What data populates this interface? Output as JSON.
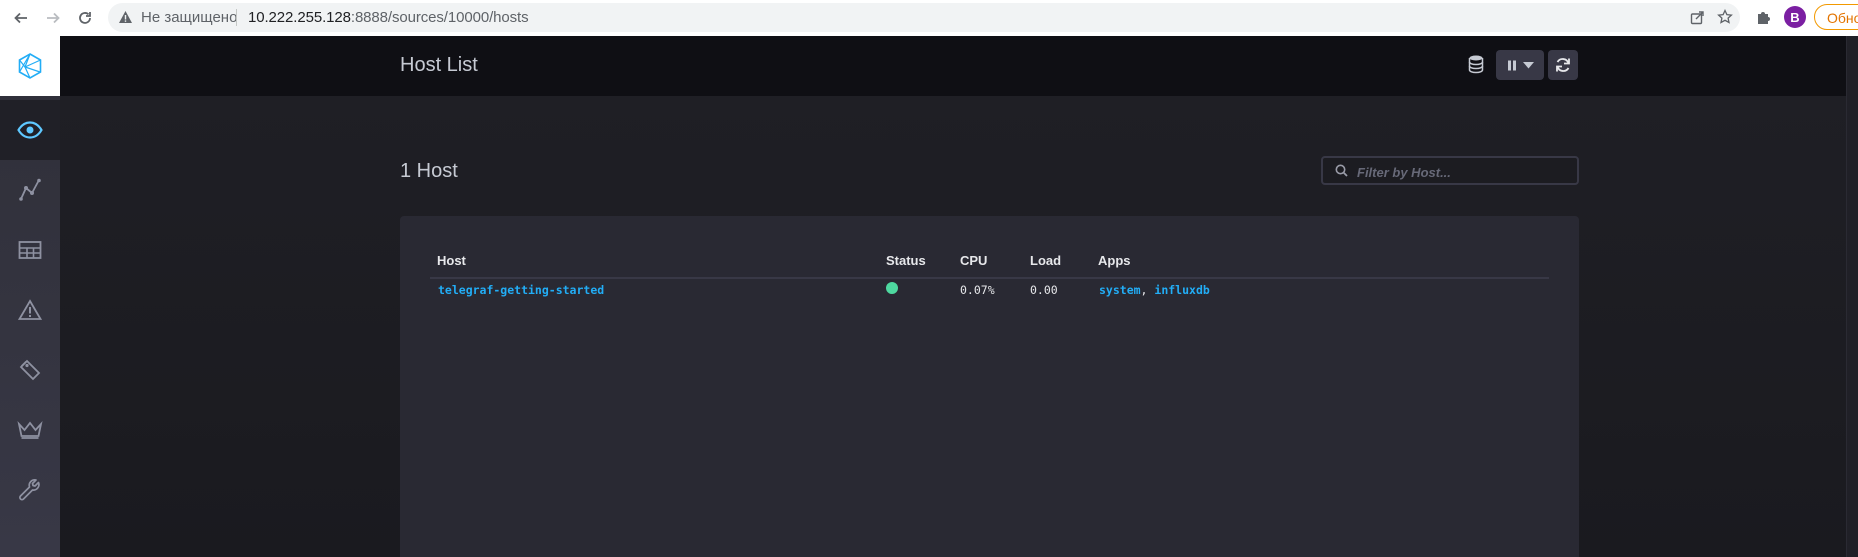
{
  "browser": {
    "security_label": "Не защищено",
    "url_host": "10.222.255.128",
    "url_rest": ":8888/sources/10000/hosts",
    "profile_initial": "B",
    "update_label": "Обновить"
  },
  "header": {
    "title": "Host List"
  },
  "sidebar": {
    "items": [
      {
        "icon": "eye-icon",
        "active": true
      },
      {
        "icon": "graph-icon",
        "active": false
      },
      {
        "icon": "dashboards-icon",
        "active": false
      },
      {
        "icon": "alert-icon",
        "active": false
      },
      {
        "icon": "tag-icon",
        "active": false
      },
      {
        "icon": "crown-icon",
        "active": false
      },
      {
        "icon": "wrench-icon",
        "active": false
      }
    ]
  },
  "main": {
    "host_count": "1 Host",
    "filter_placeholder": "Filter by Host..."
  },
  "table": {
    "headers": {
      "host": "Host",
      "status": "Status",
      "cpu": "CPU",
      "load": "Load",
      "apps": "Apps"
    },
    "rows": [
      {
        "host": "telegraf-getting-started",
        "status": "online",
        "cpu": "0.07%",
        "load": "0.00",
        "apps": [
          "system",
          "influxdb"
        ],
        "apps_sep": ", "
      }
    ]
  },
  "colors": {
    "accent_link": "#22adf6",
    "status_online": "#4ed8a0",
    "header_bg": "#0f0f14",
    "panel_bg": "#292933"
  }
}
